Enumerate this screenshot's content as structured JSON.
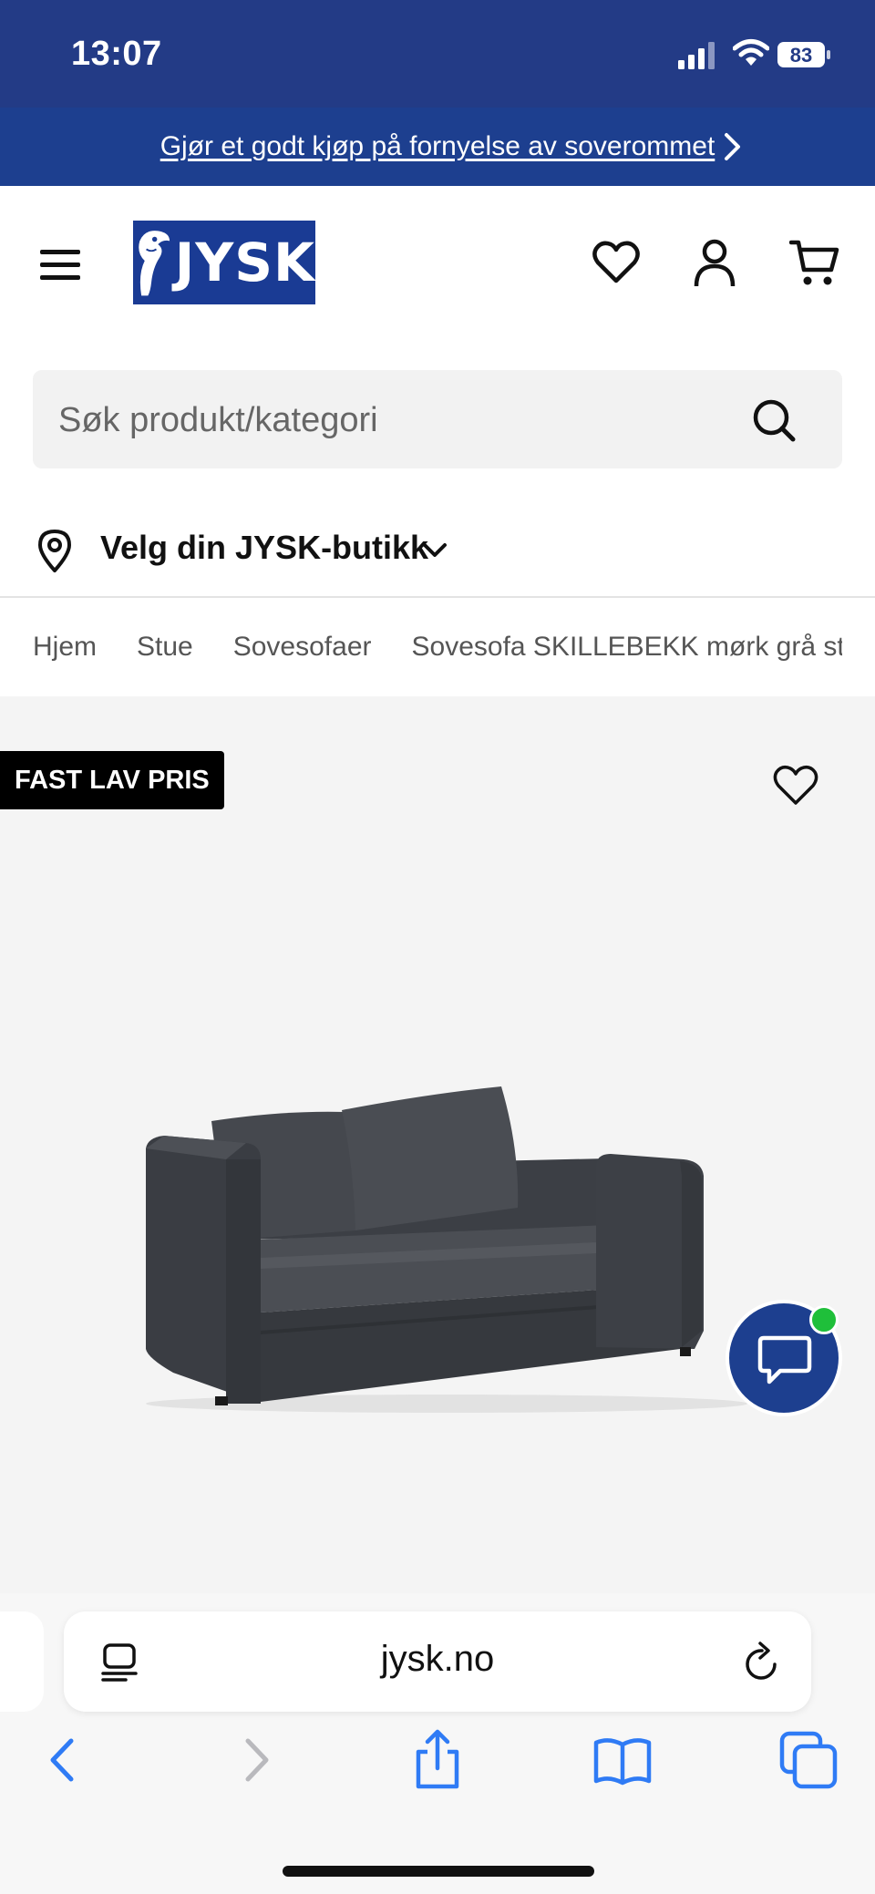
{
  "status_bar": {
    "time": "13:07",
    "battery": "83",
    "icons": [
      "signal-icon",
      "wifi-icon",
      "battery-icon"
    ]
  },
  "promo": {
    "text": "Gjør et godt kjøp på fornyelse av soverommet",
    "icon": "chevron-right-icon"
  },
  "header": {
    "logo_text": "JYSK",
    "icons": [
      "menu-icon",
      "heart-icon",
      "user-icon",
      "cart-icon"
    ]
  },
  "search": {
    "placeholder": "Søk produkt/kategori",
    "icon": "search-icon"
  },
  "store": {
    "label": "Velg din JYSK-butikk",
    "icon": "location-pin-icon"
  },
  "breadcrumb": {
    "items": [
      "Hjem",
      "Stue",
      "Sovesofaer",
      "Sovesofa SKILLEBEKK mørk grå stoff"
    ]
  },
  "product": {
    "badge": "FAST LAV PRIS",
    "image": "sofa-image",
    "chat": {
      "icon": "chat-bubble-icon",
      "online": true
    }
  },
  "browser": {
    "url": "jysk.no",
    "nav": [
      "back-icon",
      "forward-icon",
      "share-icon",
      "bookmarks-icon",
      "tabs-icon"
    ]
  },
  "colors": {
    "status_bar": "#233b86",
    "promo": "#1d3f8f",
    "brand_blue": "#1a3b94",
    "badge": "#000000",
    "online_dot": "#1fbf3a",
    "ios_blue": "#2f7bf5"
  }
}
